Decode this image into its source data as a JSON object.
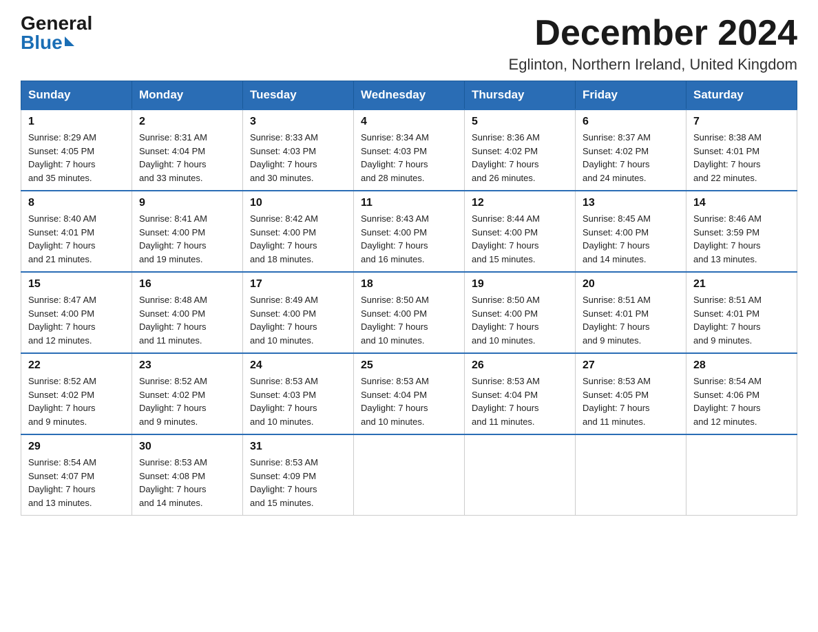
{
  "header": {
    "logo_general": "General",
    "logo_blue": "Blue",
    "month_title": "December 2024",
    "location": "Eglinton, Northern Ireland, United Kingdom"
  },
  "days_of_week": [
    "Sunday",
    "Monday",
    "Tuesday",
    "Wednesday",
    "Thursday",
    "Friday",
    "Saturday"
  ],
  "weeks": [
    [
      {
        "day": "1",
        "sunrise": "8:29 AM",
        "sunset": "4:05 PM",
        "daylight": "7 hours and 35 minutes."
      },
      {
        "day": "2",
        "sunrise": "8:31 AM",
        "sunset": "4:04 PM",
        "daylight": "7 hours and 33 minutes."
      },
      {
        "day": "3",
        "sunrise": "8:33 AM",
        "sunset": "4:03 PM",
        "daylight": "7 hours and 30 minutes."
      },
      {
        "day": "4",
        "sunrise": "8:34 AM",
        "sunset": "4:03 PM",
        "daylight": "7 hours and 28 minutes."
      },
      {
        "day": "5",
        "sunrise": "8:36 AM",
        "sunset": "4:02 PM",
        "daylight": "7 hours and 26 minutes."
      },
      {
        "day": "6",
        "sunrise": "8:37 AM",
        "sunset": "4:02 PM",
        "daylight": "7 hours and 24 minutes."
      },
      {
        "day": "7",
        "sunrise": "8:38 AM",
        "sunset": "4:01 PM",
        "daylight": "7 hours and 22 minutes."
      }
    ],
    [
      {
        "day": "8",
        "sunrise": "8:40 AM",
        "sunset": "4:01 PM",
        "daylight": "7 hours and 21 minutes."
      },
      {
        "day": "9",
        "sunrise": "8:41 AM",
        "sunset": "4:00 PM",
        "daylight": "7 hours and 19 minutes."
      },
      {
        "day": "10",
        "sunrise": "8:42 AM",
        "sunset": "4:00 PM",
        "daylight": "7 hours and 18 minutes."
      },
      {
        "day": "11",
        "sunrise": "8:43 AM",
        "sunset": "4:00 PM",
        "daylight": "7 hours and 16 minutes."
      },
      {
        "day": "12",
        "sunrise": "8:44 AM",
        "sunset": "4:00 PM",
        "daylight": "7 hours and 15 minutes."
      },
      {
        "day": "13",
        "sunrise": "8:45 AM",
        "sunset": "4:00 PM",
        "daylight": "7 hours and 14 minutes."
      },
      {
        "day": "14",
        "sunrise": "8:46 AM",
        "sunset": "3:59 PM",
        "daylight": "7 hours and 13 minutes."
      }
    ],
    [
      {
        "day": "15",
        "sunrise": "8:47 AM",
        "sunset": "4:00 PM",
        "daylight": "7 hours and 12 minutes."
      },
      {
        "day": "16",
        "sunrise": "8:48 AM",
        "sunset": "4:00 PM",
        "daylight": "7 hours and 11 minutes."
      },
      {
        "day": "17",
        "sunrise": "8:49 AM",
        "sunset": "4:00 PM",
        "daylight": "7 hours and 10 minutes."
      },
      {
        "day": "18",
        "sunrise": "8:50 AM",
        "sunset": "4:00 PM",
        "daylight": "7 hours and 10 minutes."
      },
      {
        "day": "19",
        "sunrise": "8:50 AM",
        "sunset": "4:00 PM",
        "daylight": "7 hours and 10 minutes."
      },
      {
        "day": "20",
        "sunrise": "8:51 AM",
        "sunset": "4:01 PM",
        "daylight": "7 hours and 9 minutes."
      },
      {
        "day": "21",
        "sunrise": "8:51 AM",
        "sunset": "4:01 PM",
        "daylight": "7 hours and 9 minutes."
      }
    ],
    [
      {
        "day": "22",
        "sunrise": "8:52 AM",
        "sunset": "4:02 PM",
        "daylight": "7 hours and 9 minutes."
      },
      {
        "day": "23",
        "sunrise": "8:52 AM",
        "sunset": "4:02 PM",
        "daylight": "7 hours and 9 minutes."
      },
      {
        "day": "24",
        "sunrise": "8:53 AM",
        "sunset": "4:03 PM",
        "daylight": "7 hours and 10 minutes."
      },
      {
        "day": "25",
        "sunrise": "8:53 AM",
        "sunset": "4:04 PM",
        "daylight": "7 hours and 10 minutes."
      },
      {
        "day": "26",
        "sunrise": "8:53 AM",
        "sunset": "4:04 PM",
        "daylight": "7 hours and 11 minutes."
      },
      {
        "day": "27",
        "sunrise": "8:53 AM",
        "sunset": "4:05 PM",
        "daylight": "7 hours and 11 minutes."
      },
      {
        "day": "28",
        "sunrise": "8:54 AM",
        "sunset": "4:06 PM",
        "daylight": "7 hours and 12 minutes."
      }
    ],
    [
      {
        "day": "29",
        "sunrise": "8:54 AM",
        "sunset": "4:07 PM",
        "daylight": "7 hours and 13 minutes."
      },
      {
        "day": "30",
        "sunrise": "8:53 AM",
        "sunset": "4:08 PM",
        "daylight": "7 hours and 14 minutes."
      },
      {
        "day": "31",
        "sunrise": "8:53 AM",
        "sunset": "4:09 PM",
        "daylight": "7 hours and 15 minutes."
      },
      null,
      null,
      null,
      null
    ]
  ],
  "labels": {
    "sunrise": "Sunrise:",
    "sunset": "Sunset:",
    "daylight": "Daylight:"
  }
}
